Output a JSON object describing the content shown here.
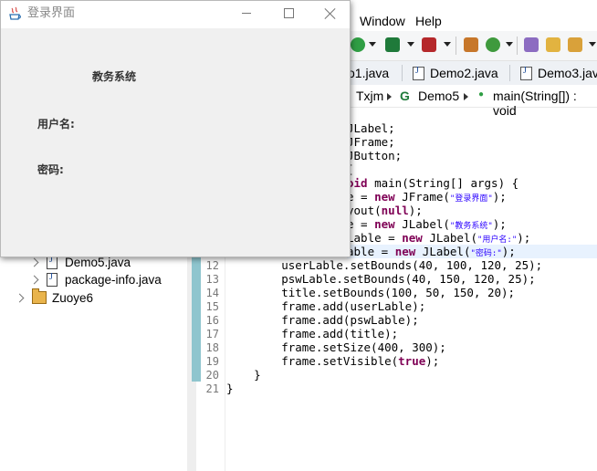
{
  "eclipse": {
    "menu": [
      "Window",
      "Help"
    ],
    "tabs": [
      "o1.java",
      "Demo2.java",
      "Demo3.java"
    ],
    "breadcrumb": [
      "Txjm",
      "Demo5",
      "main(String[]) : void"
    ],
    "explorer": {
      "items": [
        "Demo5.java",
        "package-info.java",
        "Zuoye6"
      ]
    },
    "code": {
      "line_numbers": [
        "12",
        "13",
        "14",
        "15",
        "16",
        "17",
        "18",
        "19",
        "20",
        "21"
      ],
      "lines": [
        {
          "plain": "JLabel;"
        },
        {
          "plain": "JFrame;"
        },
        {
          "plain": "JButton;"
        },
        {
          "plain": "["
        },
        {
          "kw": "oid",
          "plain": " main(String[] args) {"
        },
        {
          "plain": "e = ",
          "kw": "new",
          "plain2": " JFrame(",
          "str": "\"登录界面\"",
          "plain3": ");"
        },
        {
          "plain": "yout(",
          "kw": "null",
          "plain2": ");"
        },
        {
          "plain": "e = ",
          "kw": "new",
          "plain2": " JLabel(",
          "str": "\"教务系统\"",
          "plain3": ");"
        },
        {
          "plain": "Lable = ",
          "kw": "new",
          "plain2": " JLabel(",
          "str": "\"用户名:\"",
          "plain3": ");"
        },
        {
          "plain": "able = ",
          "kw": "new",
          "plain2": " JLabel(",
          "str": "\"密码:\"",
          "plain3": ");"
        },
        {
          "plain": "        userLable.setBounds(40, 100, 120, 25);"
        },
        {
          "plain": "        pswLable.setBounds(40, 150, 120, 25);"
        },
        {
          "plain": "        title.setBounds(100, 50, 150, 20);"
        },
        {
          "plain": "        frame.add(userLable);"
        },
        {
          "plain": "        frame.add(pswLable);"
        },
        {
          "plain": "        frame.add(title);"
        },
        {
          "plain": "        frame.setSize(400, 300);"
        },
        {
          "plain": "        frame.setVisible(",
          "kw": "true",
          "plain2": ");"
        },
        {
          "plain": "    }"
        },
        {
          "plain": "}"
        }
      ]
    }
  },
  "login_window": {
    "title": "登录界面",
    "heading": "教务系统",
    "username_label": "用户名:",
    "password_label": "密码:"
  },
  "colors": {
    "keyword": "#7f0055",
    "string": "#2a00ff",
    "window_bg": "#f0f0f0"
  }
}
